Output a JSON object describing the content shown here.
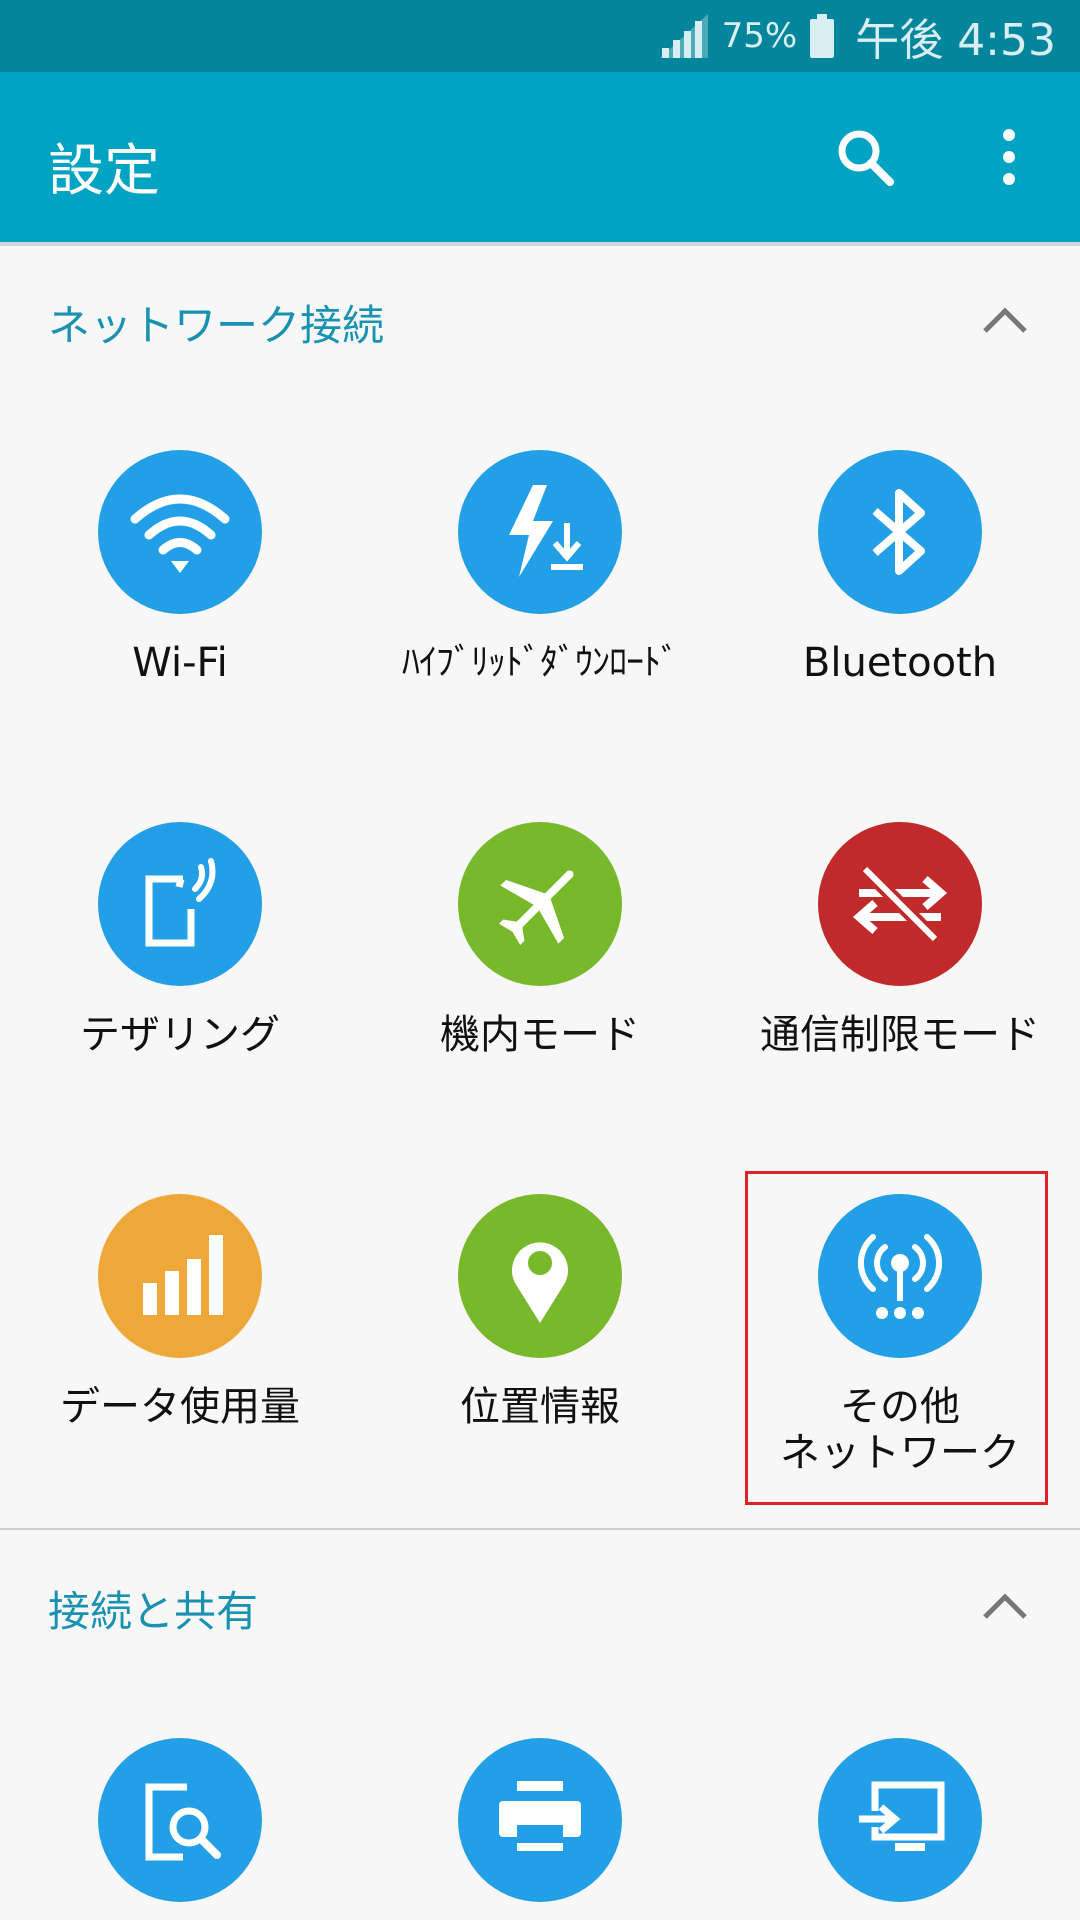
{
  "status_bar": {
    "battery_pct": "75%",
    "time": "午後 4:53"
  },
  "app_bar": {
    "title": "設定"
  },
  "sections": [
    {
      "title": "ネットワーク接続",
      "items": [
        {
          "label": "Wi-Fi",
          "icon": "wifi-icon",
          "color": "#239fe8"
        },
        {
          "label": "ﾊｲﾌﾞﾘｯﾄﾞﾀﾞｳﾝﾛｰﾄﾞ",
          "icon": "bolt-download-icon",
          "color": "#239fe8"
        },
        {
          "label": "Bluetooth",
          "icon": "bluetooth-icon",
          "color": "#239fe8"
        },
        {
          "label": "テザリング",
          "icon": "tethering-icon",
          "color": "#239fe8"
        },
        {
          "label": "機内モード",
          "icon": "airplane-icon",
          "color": "#78b82b"
        },
        {
          "label": "通信制限モード",
          "icon": "data-restrict-icon",
          "color": "#c02a2a"
        },
        {
          "label": "データ使用量",
          "icon": "signal-bars-icon",
          "color": "#eea83a"
        },
        {
          "label": "位置情報",
          "icon": "location-pin-icon",
          "color": "#78b82b"
        },
        {
          "label": "その他\nネットワーク",
          "icon": "antenna-icon",
          "color": "#239fe8"
        }
      ]
    },
    {
      "title": "接続と共有",
      "items": [
        {
          "icon": "device-search-icon",
          "color": "#239fe8"
        },
        {
          "icon": "printer-icon",
          "color": "#239fe8"
        },
        {
          "icon": "screen-mirroring-icon",
          "color": "#239fe8"
        }
      ]
    }
  ]
}
